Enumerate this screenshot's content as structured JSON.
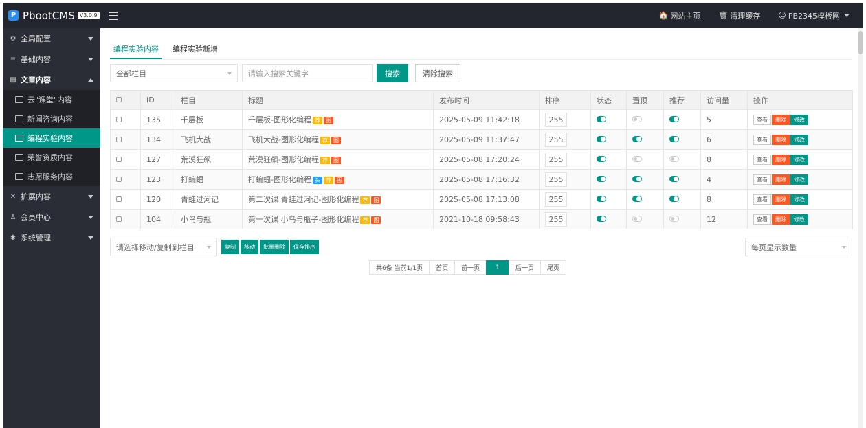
{
  "app": {
    "name": "PbootCMS",
    "version": "V3.0.9"
  },
  "topnav": [
    {
      "icon": "home-icon",
      "glyph": "🏠",
      "label": "网站主页"
    },
    {
      "icon": "trash-icon",
      "glyph": "🗑",
      "label": "清理缓存"
    },
    {
      "icon": "user-icon",
      "glyph": "☺",
      "label": "PB2345模板网"
    }
  ],
  "sidebar": {
    "groups": [
      {
        "icon": "gear-icon",
        "glyph": "⚙",
        "label": "全局配置"
      },
      {
        "icon": "sliders-icon",
        "glyph": "≡",
        "label": "基础内容"
      },
      {
        "icon": "document-icon",
        "glyph": "▤",
        "label": "文章内容"
      },
      {
        "icon": "expand-icon",
        "glyph": "✕",
        "label": "扩展内容"
      },
      {
        "icon": "member-icon",
        "glyph": "♙",
        "label": "会员中心"
      },
      {
        "icon": "system-icon",
        "glyph": "✱",
        "label": "系统管理"
      }
    ],
    "items": [
      "云\"课堂\"内容",
      "新闻咨询内容",
      "编程实验内容",
      "荣誉资质内容",
      "志愿服务内容"
    ]
  },
  "tabs": [
    "编程实验内容",
    "编程实验新增"
  ],
  "search": {
    "category": "全部栏目",
    "placeholder": "请输入搜索关键字",
    "search_btn": "搜索",
    "clear_btn": "清除搜索"
  },
  "table": {
    "headers": [
      "ID",
      "栏目",
      "标题",
      "发布时间",
      "排序",
      "状态",
      "置顶",
      "推荐",
      "访问量",
      "操作"
    ],
    "rows": [
      {
        "id": "135",
        "col": "千层板",
        "title": "千层板-图形化编程",
        "time": "2025-05-09 11:42:18",
        "sort": "255",
        "visits": "5"
      },
      {
        "id": "134",
        "col": "飞机大战",
        "title": "飞机大战-图形化编程",
        "time": "2025-05-09 11:37:47",
        "sort": "255",
        "visits": "6"
      },
      {
        "id": "127",
        "col": "荒漠狂飙",
        "title": "荒漠狂飙-图形化编程",
        "time": "2025-05-08 17:20:24",
        "sort": "255",
        "visits": "8"
      },
      {
        "id": "123",
        "col": "打蝙蝠",
        "title": "打蝙蝠-图形化编程",
        "time": "2025-05-08 17:16:32",
        "sort": "255",
        "visits": "4"
      },
      {
        "id": "120",
        "col": "青蛙过河记",
        "title": "第二次课 青蛙过河记-图形化编程",
        "time": "2025-05-08 17:13:08",
        "sort": "255",
        "visits": "8"
      },
      {
        "id": "104",
        "col": "小鸟与瓶",
        "title": "第一次课 小鸟与瓶子-图形化编程",
        "time": "2021-10-18 09:58:43",
        "sort": "255",
        "visits": "12"
      }
    ],
    "tags": {
      "head": "头",
      "rec": "荐",
      "img": "图"
    },
    "ops": {
      "view": "查看",
      "delete": "删除",
      "edit": "修改"
    }
  },
  "bulk": {
    "select": "请选择移动/复制到栏目",
    "copy": "复制",
    "move": "移动",
    "batch_delete": "批量删除",
    "save_sort": "保存排序",
    "per_page": "每页显示数量"
  },
  "pager": {
    "summary": "共6条 当前1/1页",
    "first": "首页",
    "prev": "前一页",
    "current": "1",
    "next": "后一页",
    "last": "尾页"
  },
  "colors": {
    "accent": "#009688",
    "danger": "#ff5722",
    "warn": "#ffb800",
    "info": "#1e9fff"
  }
}
